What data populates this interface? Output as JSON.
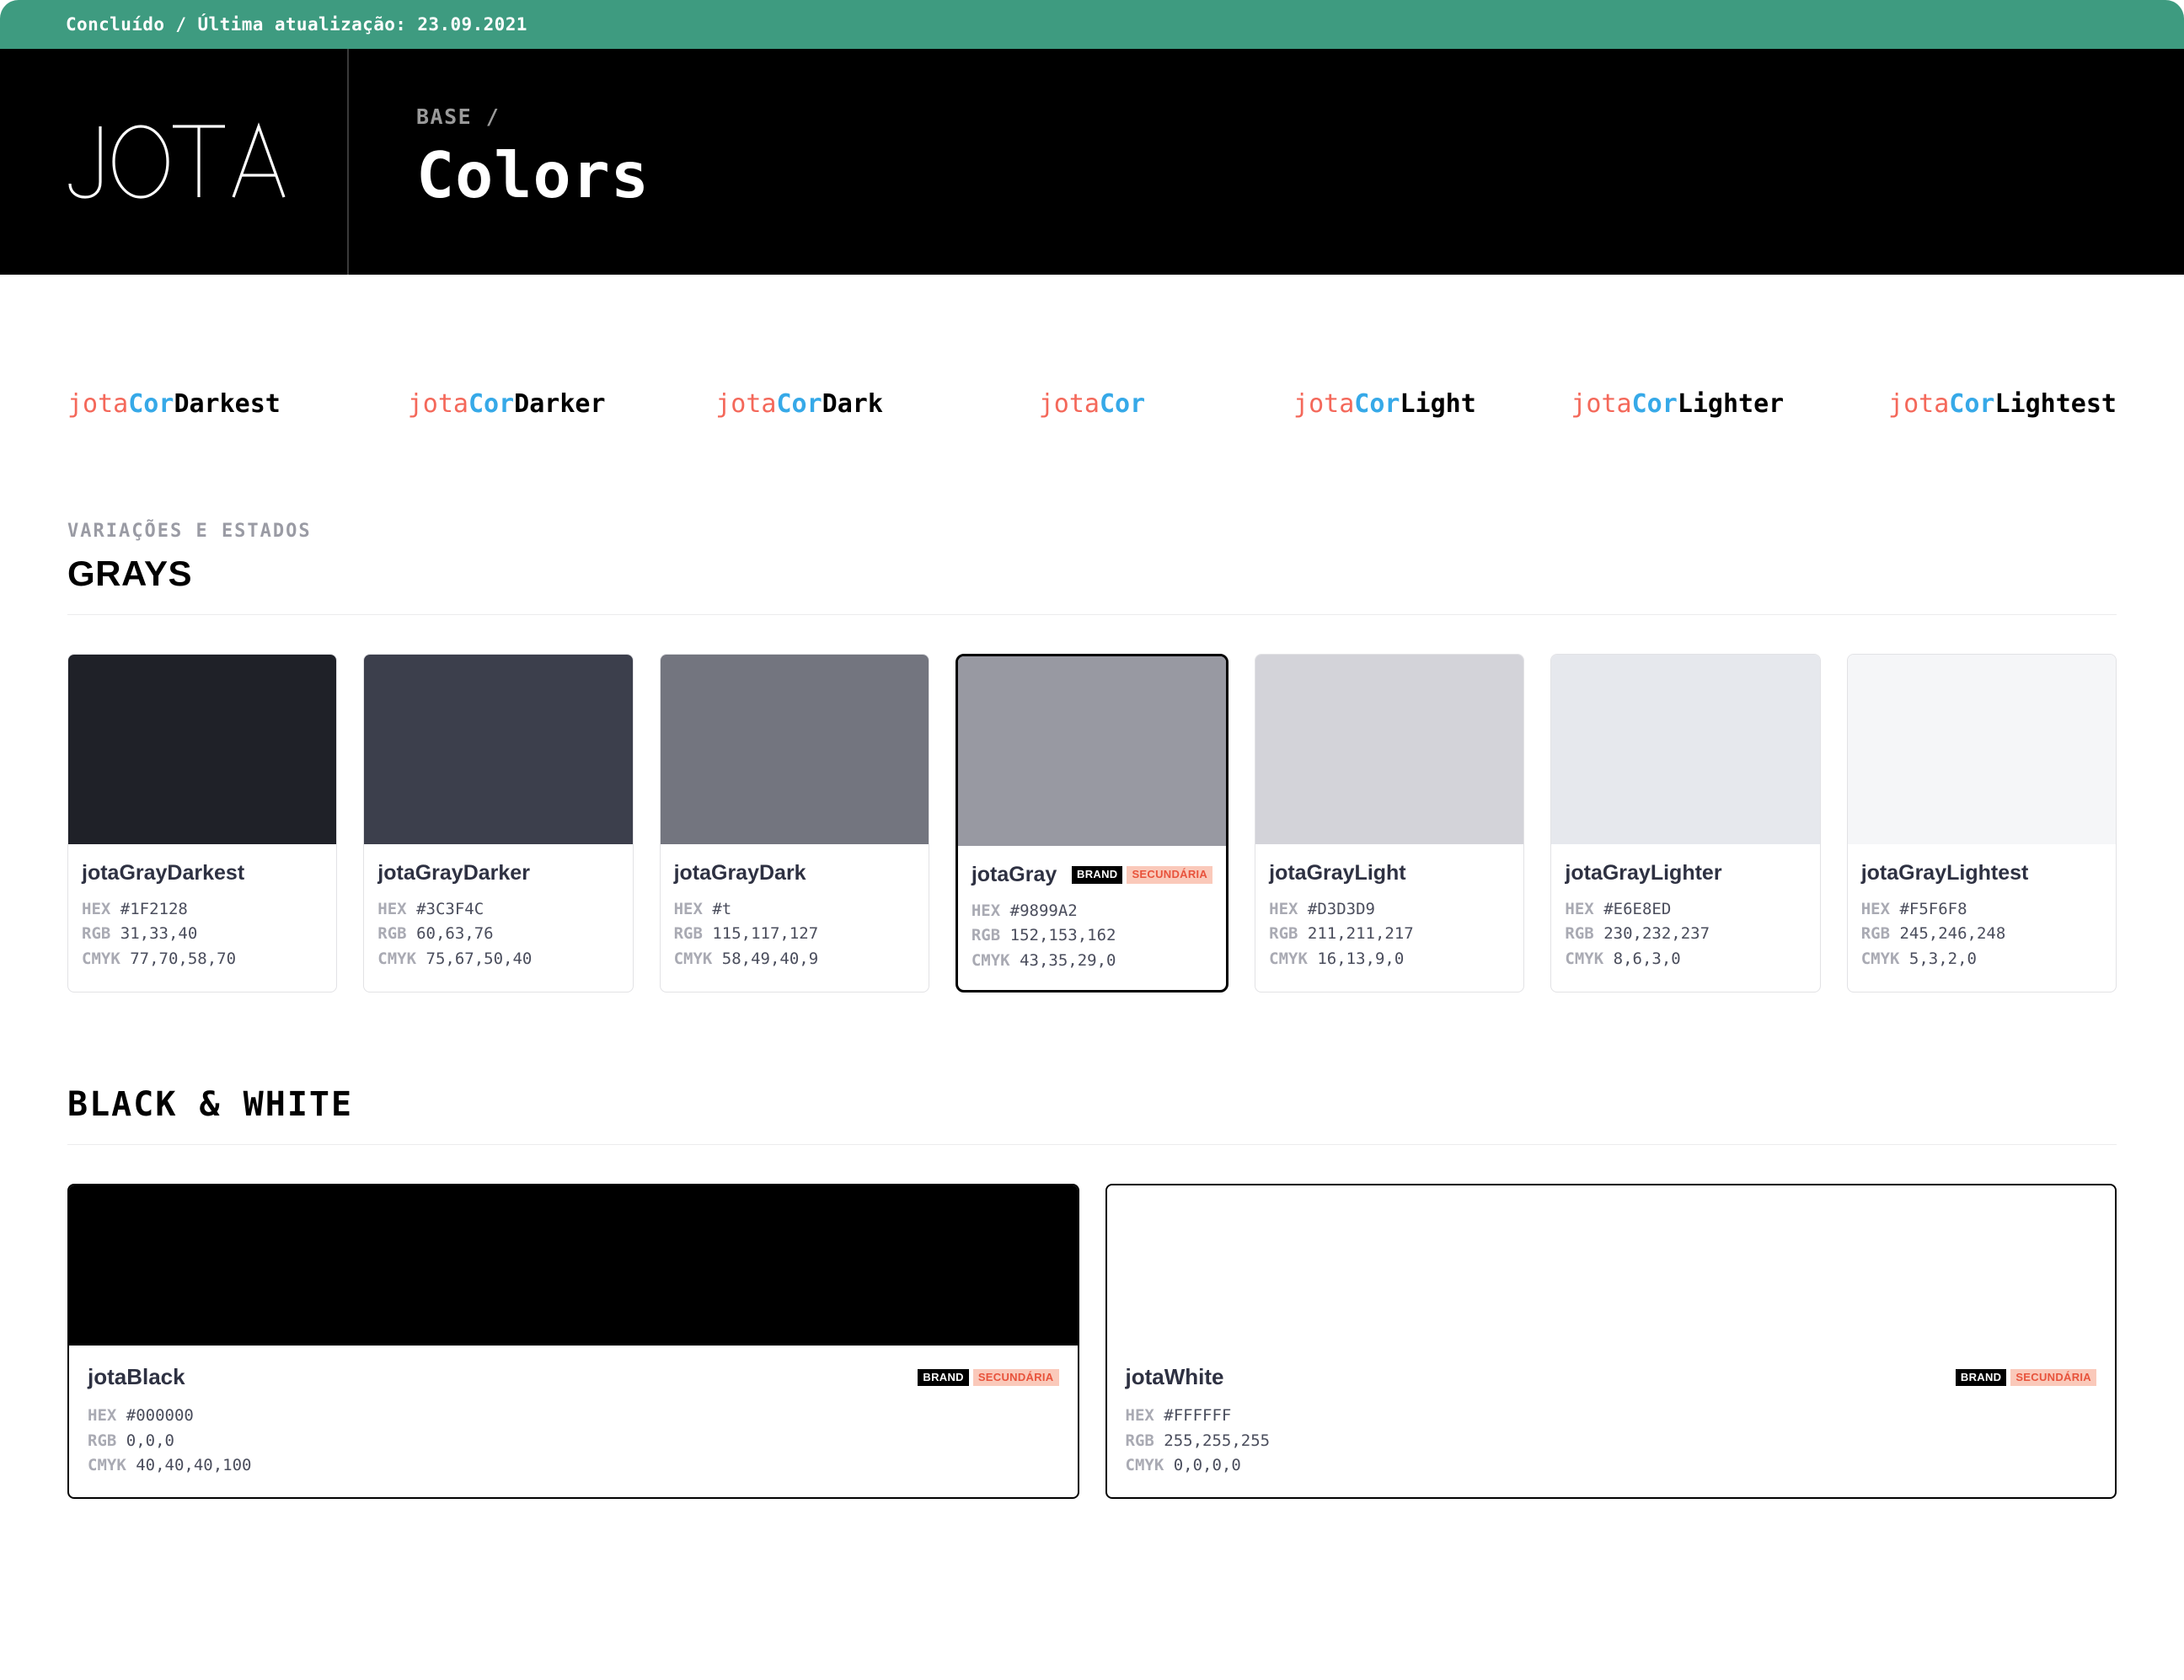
{
  "statusbar": {
    "text": "Concluído / Última atualização: 23.09.2021",
    "background": "#3E9B80"
  },
  "header": {
    "logo_text": "JOTA",
    "breadcrumb": "BASE /",
    "title": "Colors",
    "background": "#000000"
  },
  "naming_convention": {
    "prefix": "jota",
    "middle": "Cor",
    "prefix_color": "#F4685A",
    "middle_color": "#36A9E8",
    "suffix_color": "#000000",
    "items": [
      {
        "prefix": "jota",
        "middle": "Cor",
        "suffix": "Darkest"
      },
      {
        "prefix": "jota",
        "middle": "Cor",
        "suffix": "Darker"
      },
      {
        "prefix": "jota",
        "middle": "Cor",
        "suffix": "Dark"
      },
      {
        "prefix": "jota",
        "middle": "Cor",
        "suffix": ""
      },
      {
        "prefix": "jota",
        "middle": "Cor",
        "suffix": "Light"
      },
      {
        "prefix": "jota",
        "middle": "Cor",
        "suffix": "Lighter"
      },
      {
        "prefix": "jota",
        "middle": "Cor",
        "suffix": "Lightest"
      }
    ]
  },
  "grays_section": {
    "eyebrow": "VARIAÇÕES E ESTADOS",
    "title": "GRAYS",
    "labels": {
      "hex": "HEX",
      "rgb": "RGB",
      "cmyk": "CMYK"
    },
    "swatches": [
      {
        "name": "jotaGrayDarkest",
        "swatch": "#1F2128",
        "hex": "#1F2128",
        "rgb": "31,33,40",
        "cmyk": "77,70,58,70",
        "selected": false,
        "badges": []
      },
      {
        "name": "jotaGrayDarker",
        "swatch": "#3C3F4C",
        "hex": "#3C3F4C",
        "rgb": "60,63,76",
        "cmyk": "75,67,50,40",
        "selected": false,
        "badges": []
      },
      {
        "name": "jotaGrayDark",
        "swatch": "#73757F",
        "hex": "#t",
        "rgb": "115,117,127",
        "cmyk": "58,49,40,9",
        "selected": false,
        "badges": []
      },
      {
        "name": "jotaGray",
        "swatch": "#9899A2",
        "hex": "#9899A2",
        "rgb": "152,153,162",
        "cmyk": "43,35,29,0",
        "selected": true,
        "badges": [
          "BRAND",
          "SECUNDÁRIA"
        ]
      },
      {
        "name": "jotaGrayLight",
        "swatch": "#D3D3D9",
        "hex": "#D3D3D9",
        "rgb": "211,211,217",
        "cmyk": "16,13,9,0",
        "selected": false,
        "badges": []
      },
      {
        "name": "jotaGrayLighter",
        "swatch": "#E6E8ED",
        "hex": "#E6E8ED",
        "rgb": "230,232,237",
        "cmyk": "8,6,3,0",
        "selected": false,
        "badges": []
      },
      {
        "name": "jotaGrayLightest",
        "swatch": "#F5F6F8",
        "hex": "#F5F6F8",
        "rgb": "245,246,248",
        "cmyk": "5,3,2,0",
        "selected": false,
        "badges": []
      }
    ]
  },
  "blackwhite_section": {
    "title": "BLACK & WHITE",
    "labels": {
      "hex": "HEX",
      "rgb": "RGB",
      "cmyk": "CMYK"
    },
    "swatches": [
      {
        "name": "jotaBlack",
        "swatch": "#000000",
        "hex": "#000000",
        "rgb": "0,0,0",
        "cmyk": "40,40,40,100",
        "badges": [
          "BRAND",
          "SECUNDÁRIA"
        ]
      },
      {
        "name": "jotaWhite",
        "swatch": "#FFFFFF",
        "hex": "#FFFFFF",
        "rgb": "255,255,255",
        "cmyk": "0,0,0,0",
        "badges": [
          "BRAND",
          "SECUNDÁRIA"
        ]
      }
    ]
  },
  "badge_colors": {
    "brand_bg": "#000000",
    "brand_text": "#FFFFFF",
    "secundaria_bg": "#FAC9BA",
    "secundaria_text": "#E8533C"
  }
}
